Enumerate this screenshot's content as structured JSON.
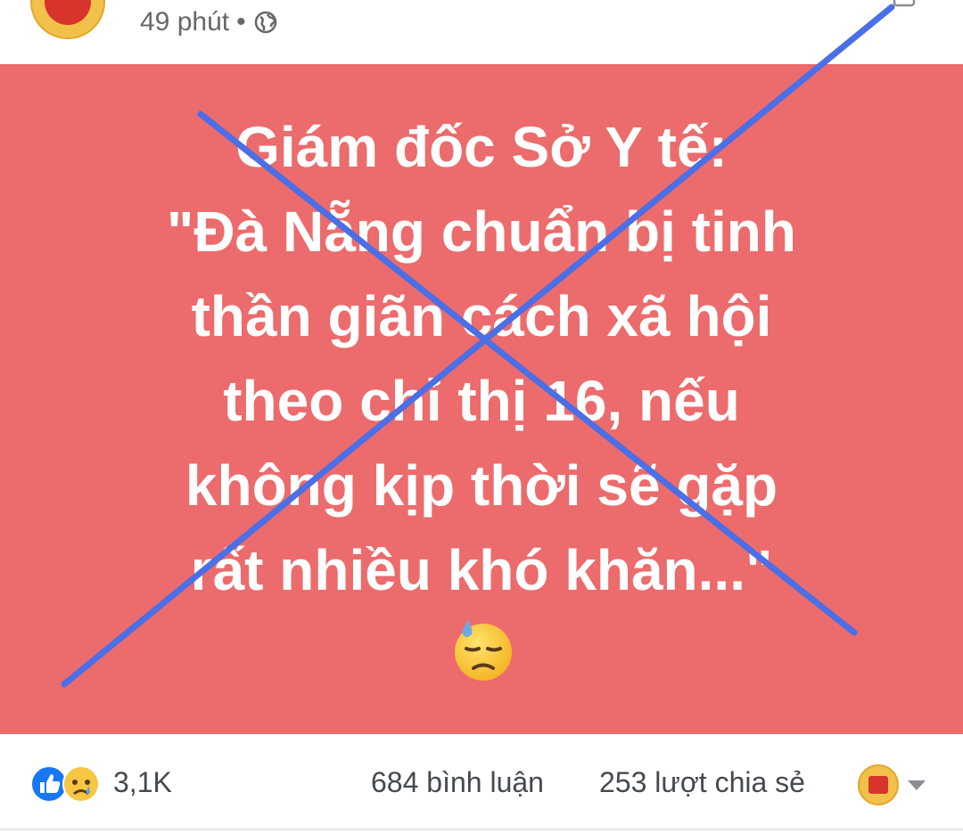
{
  "post": {
    "time_label": "49 phút",
    "separator": "•",
    "privacy_icon": "globe-icon",
    "text_lines": [
      "Giám đốc Sở Y tế:",
      "\"Đà Nẵng chuẩn bị tinh",
      "thần giãn cách xã hội",
      "theo chỉ thị 16, nếu",
      "không kịp thời sẽ gặp",
      "rất nhiều khó khăn...\""
    ],
    "emoji": "downcast-face-with-sweat-icon",
    "card_color": "#ec6b6c",
    "overlay_mark": "blue-x-cross",
    "overlay_color": "#4a6fe6"
  },
  "footer": {
    "reaction_icons": [
      "like-icon",
      "sad-icon"
    ],
    "reaction_count": "3,1K",
    "comments": "684 bình luận",
    "shares": "253 lượt chia sẻ"
  }
}
